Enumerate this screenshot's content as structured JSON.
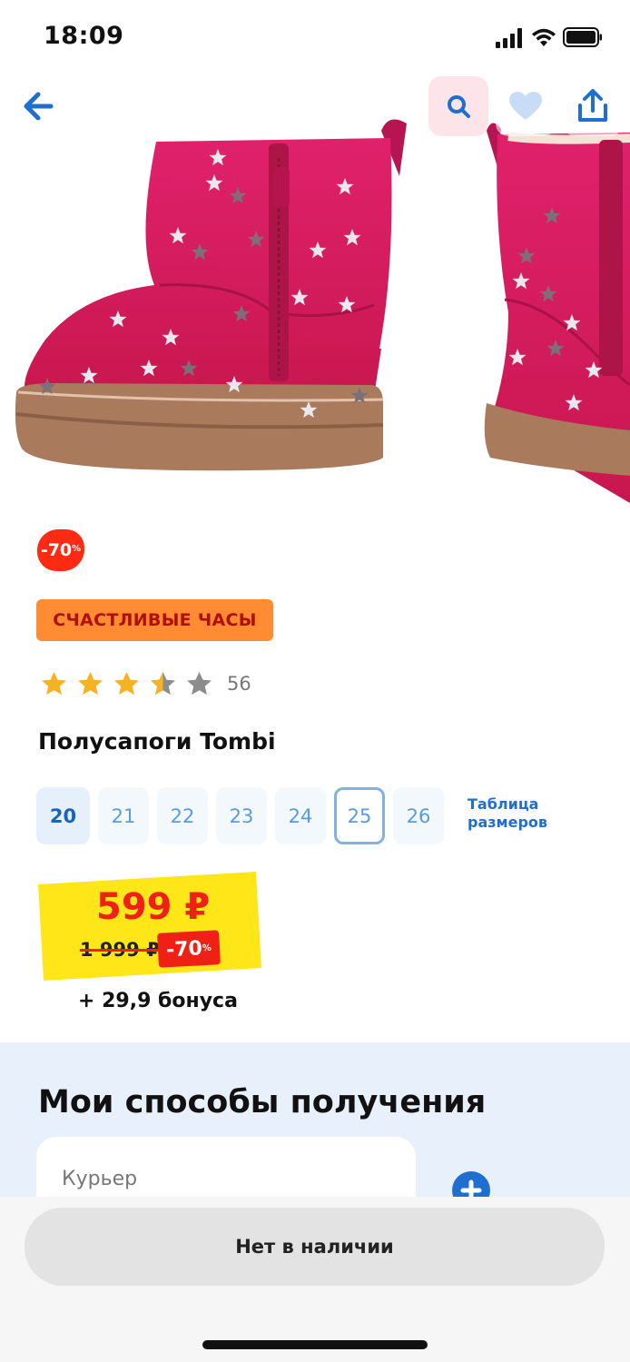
{
  "status_bar": {
    "time": "18:09"
  },
  "header": {
    "icons": [
      "back-arrow-icon",
      "search-icon",
      "heart-icon",
      "share-icon"
    ],
    "accent": "#1e6fd0"
  },
  "product": {
    "discount_sticker": {
      "value": "-70",
      "unit": "%"
    },
    "promo_badge": "СЧАСТЛИВЫЕ ЧАСЫ",
    "rating": {
      "value": 3.5,
      "max": 5,
      "count": "56"
    },
    "title": "Полусапоги Tombi",
    "sizes": [
      {
        "label": "20",
        "state": "selected"
      },
      {
        "label": "21",
        "state": "default"
      },
      {
        "label": "22",
        "state": "default"
      },
      {
        "label": "23",
        "state": "default"
      },
      {
        "label": "24",
        "state": "default"
      },
      {
        "label": "25",
        "state": "outlined"
      },
      {
        "label": "26",
        "state": "default"
      }
    ],
    "size_table_link": {
      "line1": "Таблица",
      "line2": "размеров"
    },
    "price": {
      "current": "599 ₽",
      "old": "1 999 ₽",
      "discount": "-70",
      "discount_unit": "%"
    },
    "bonus": "+ 29,9 бонуса"
  },
  "delivery": {
    "title": "Мои способы получения",
    "card_label": "Курьер"
  },
  "cta": {
    "label": "Нет в наличии"
  },
  "colors": {
    "sale_red": "#ef2014",
    "promo_orange": "#ff8c33",
    "price_yellow": "#ffe619",
    "boot_pink": "#d81b60"
  }
}
